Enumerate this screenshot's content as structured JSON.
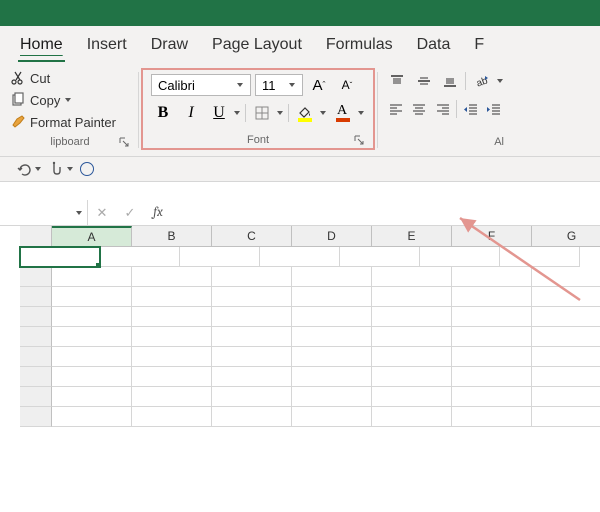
{
  "tabs": {
    "home": "Home",
    "insert": "Insert",
    "draw": "Draw",
    "page_layout": "Page Layout",
    "formulas": "Formulas",
    "data": "Data",
    "partial": "F"
  },
  "clipboard": {
    "cut": "Cut",
    "copy": "Copy",
    "format_painter": "Format Painter",
    "group_label": "lipboard"
  },
  "font": {
    "name": "Calibri",
    "size": "11",
    "bold": "B",
    "italic": "I",
    "underline": "U",
    "grow": "A",
    "shrink": "A",
    "font_color_letter": "A",
    "group_label": "Font"
  },
  "alignment": {
    "group_label_partial": "Al"
  },
  "formula_bar": {
    "name_box_value": "",
    "cancel": "✕",
    "enter": "✓",
    "fx": "fx",
    "formula_value": ""
  },
  "grid": {
    "columns": [
      "A",
      "B",
      "C",
      "D",
      "E",
      "F",
      "G"
    ],
    "selected_cell": "A1",
    "selected_col": "A"
  }
}
